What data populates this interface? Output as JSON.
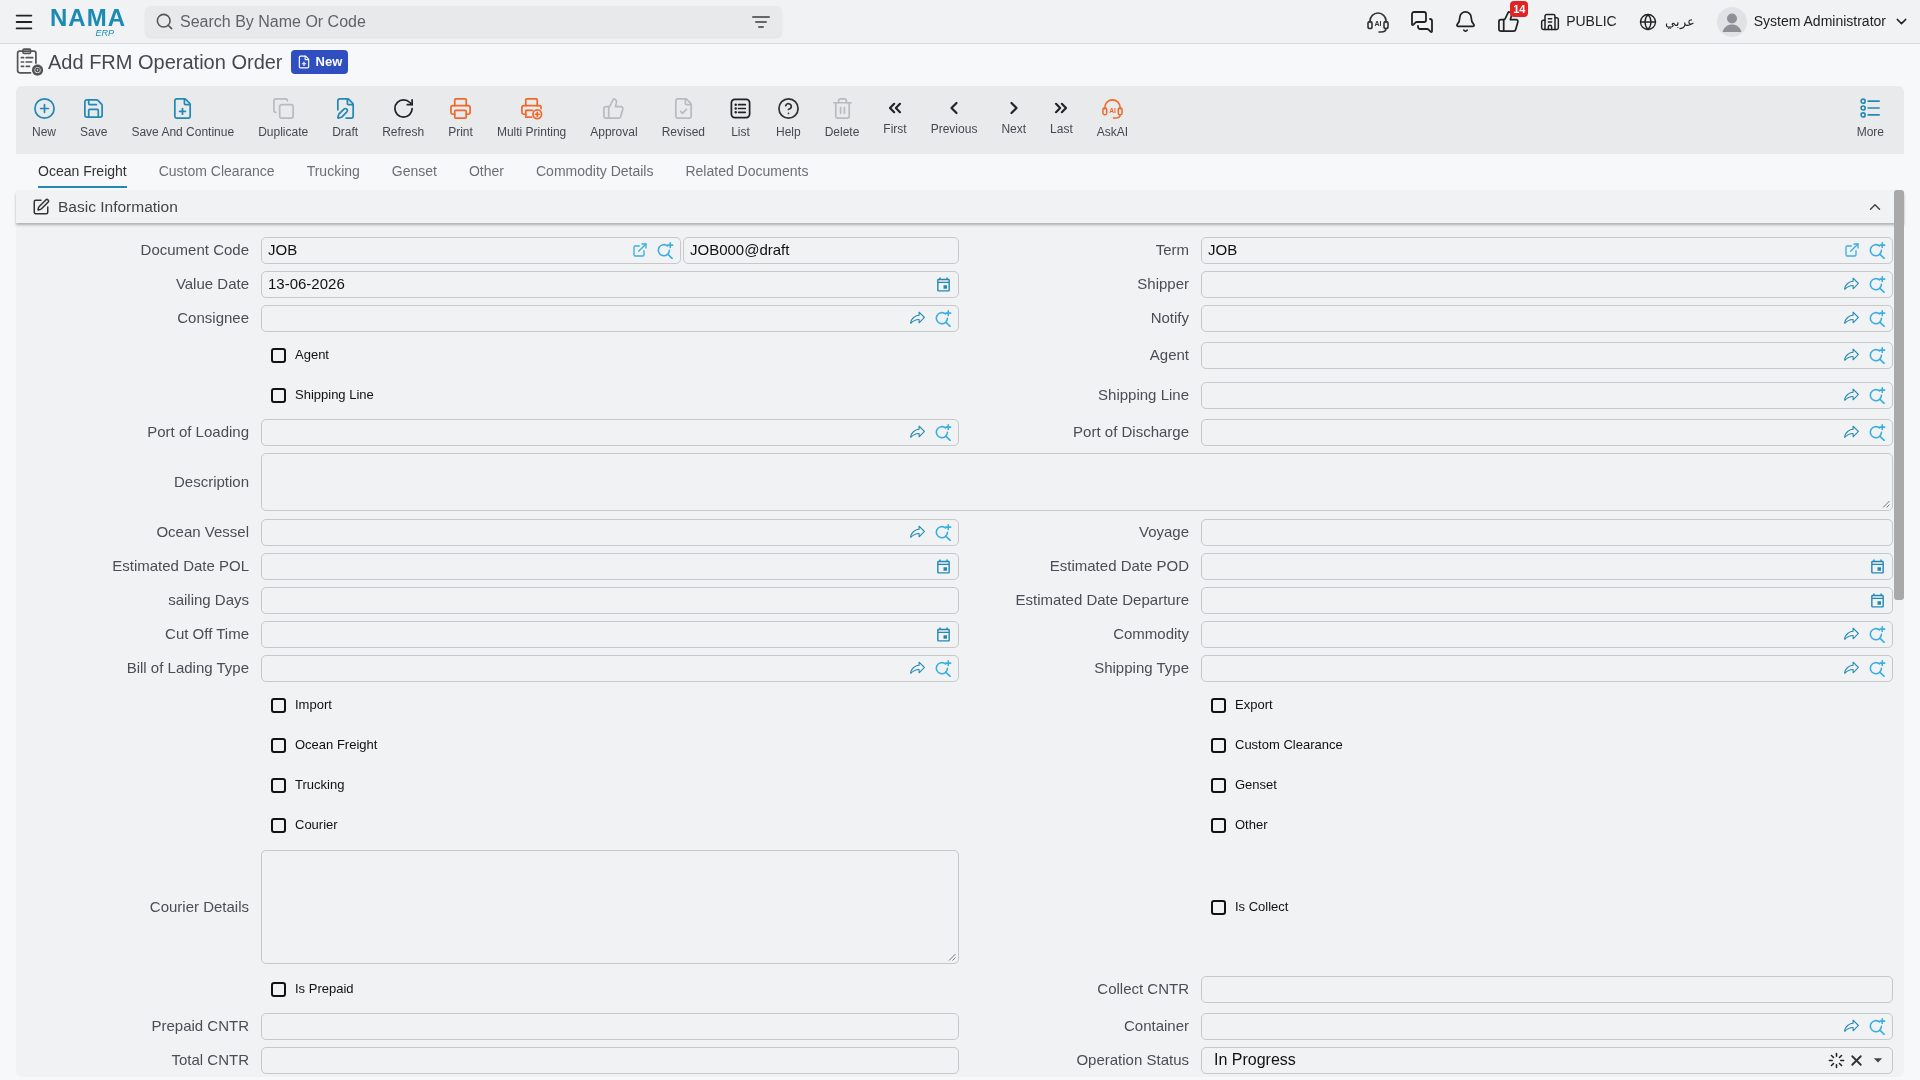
{
  "top_bar": {
    "logo": {
      "name": "NAMA",
      "suffix": "ERP"
    },
    "search": {
      "placeholder": "Search By Name Or Code"
    },
    "ai_icon_text": "AI",
    "notification_count": "14",
    "company": "PUBLIC",
    "language": "عربي",
    "user": "System Administrator"
  },
  "page": {
    "title": "Add FRM Operation Order",
    "badge": "New"
  },
  "toolbar": [
    {
      "label": "New",
      "disabled": false
    },
    {
      "label": "Save",
      "disabled": false
    },
    {
      "label": "Save And Continue",
      "disabled": false
    },
    {
      "label": "Duplicate",
      "disabled": true
    },
    {
      "label": "Draft",
      "disabled": false
    },
    {
      "label": "Refresh",
      "disabled": false
    },
    {
      "label": "Print",
      "disabled": false
    },
    {
      "label": "Multi Printing",
      "disabled": false
    },
    {
      "label": "Approval",
      "disabled": true
    },
    {
      "label": "Revised",
      "disabled": true
    },
    {
      "label": "List",
      "disabled": false
    },
    {
      "label": "Help",
      "disabled": false
    },
    {
      "label": "Delete",
      "disabled": true
    },
    {
      "label": "First",
      "disabled": false
    },
    {
      "label": "Previous",
      "disabled": false
    },
    {
      "label": "Next",
      "disabled": false
    },
    {
      "label": "Last",
      "disabled": false
    },
    {
      "label": "AskAI",
      "icon_text": "AI",
      "disabled": false
    }
  ],
  "toolbar_more": {
    "label": "More"
  },
  "tabs": [
    {
      "label": "Ocean Freight",
      "selected": true
    },
    {
      "label": "Custom Clearance",
      "selected": false
    },
    {
      "label": "Trucking",
      "selected": false
    },
    {
      "label": "Genset",
      "selected": false
    },
    {
      "label": "Other",
      "selected": false
    },
    {
      "label": "Commodity Details",
      "selected": false
    },
    {
      "label": "Related Documents",
      "selected": false
    }
  ],
  "section": {
    "title": "Basic Information",
    "expanded": true
  },
  "rows": [
    {
      "left": {
        "kind": "code",
        "label": "Document Code",
        "value": "JOB",
        "extra_value": "JOB000@draft"
      },
      "right": {
        "kind": "code",
        "label": "Term",
        "value": "JOB"
      }
    },
    {
      "left": {
        "kind": "date",
        "label": "Value Date",
        "value": "13-06-2026"
      },
      "right": {
        "kind": "lookup",
        "label": "Shipper"
      }
    },
    {
      "left": {
        "kind": "lookup",
        "label": "Consignee"
      },
      "right": {
        "kind": "lookup",
        "label": "Notify"
      }
    },
    {
      "left": {
        "kind": "checkbox",
        "label": "Agent",
        "checked": false
      },
      "right": {
        "kind": "lookup",
        "label": "Agent"
      }
    },
    {
      "left": {
        "kind": "checkbox",
        "label": "Shipping Line",
        "checked": false
      },
      "right": {
        "kind": "lookup",
        "label": "Shipping Line"
      }
    },
    {
      "left": {
        "kind": "lookup",
        "label": "Port of Loading"
      },
      "right": {
        "kind": "lookup",
        "label": "Port of Discharge"
      }
    },
    {
      "full": {
        "kind": "textarea",
        "label": "Description"
      }
    },
    {
      "left": {
        "kind": "lookup",
        "label": "Ocean Vessel"
      },
      "right": {
        "kind": "text",
        "label": "Voyage"
      }
    },
    {
      "left": {
        "kind": "date",
        "label": "Estimated Date POL"
      },
      "right": {
        "kind": "date",
        "label": "Estimated Date POD"
      }
    },
    {
      "left": {
        "kind": "text",
        "label": "sailing Days"
      },
      "right": {
        "kind": "date",
        "label": "Estimated Date Departure"
      }
    },
    {
      "left": {
        "kind": "date",
        "label": "Cut Off Time"
      },
      "right": {
        "kind": "lookup",
        "label": "Commodity"
      }
    },
    {
      "left": {
        "kind": "lookup",
        "label": "Bill of Lading Type"
      },
      "right": {
        "kind": "lookup",
        "label": "Shipping Type"
      }
    },
    {
      "left": {
        "kind": "checkbox",
        "label": "Import",
        "checked": false
      },
      "right": {
        "kind": "checkbox",
        "label": "Export",
        "checked": false
      }
    },
    {
      "left": {
        "kind": "checkbox",
        "label": "Ocean Freight",
        "checked": false
      },
      "right": {
        "kind": "checkbox",
        "label": "Custom Clearance",
        "checked": false
      }
    },
    {
      "left": {
        "kind": "checkbox",
        "label": "Trucking",
        "checked": false
      },
      "right": {
        "kind": "checkbox",
        "label": "Genset",
        "checked": false
      }
    },
    {
      "left": {
        "kind": "checkbox",
        "label": "Courier",
        "checked": false
      },
      "right": {
        "kind": "checkbox",
        "label": "Other",
        "checked": false
      }
    },
    {
      "left": {
        "kind": "textarea",
        "label": "Courier Details"
      },
      "right": {
        "kind": "checkbox",
        "label": "Is Collect",
        "checked": false
      }
    },
    {
      "left": {
        "kind": "checkbox",
        "label": "Is Prepaid",
        "checked": false
      },
      "right": {
        "kind": "text",
        "label": "Collect CNTR"
      }
    },
    {
      "left": {
        "kind": "text",
        "label": "Prepaid CNTR"
      },
      "right": {
        "kind": "lookup",
        "label": "Container"
      }
    },
    {
      "left": {
        "kind": "text",
        "label": "Total CNTR"
      },
      "right": {
        "kind": "status",
        "label": "Operation Status",
        "value": "In Progress"
      }
    }
  ]
}
